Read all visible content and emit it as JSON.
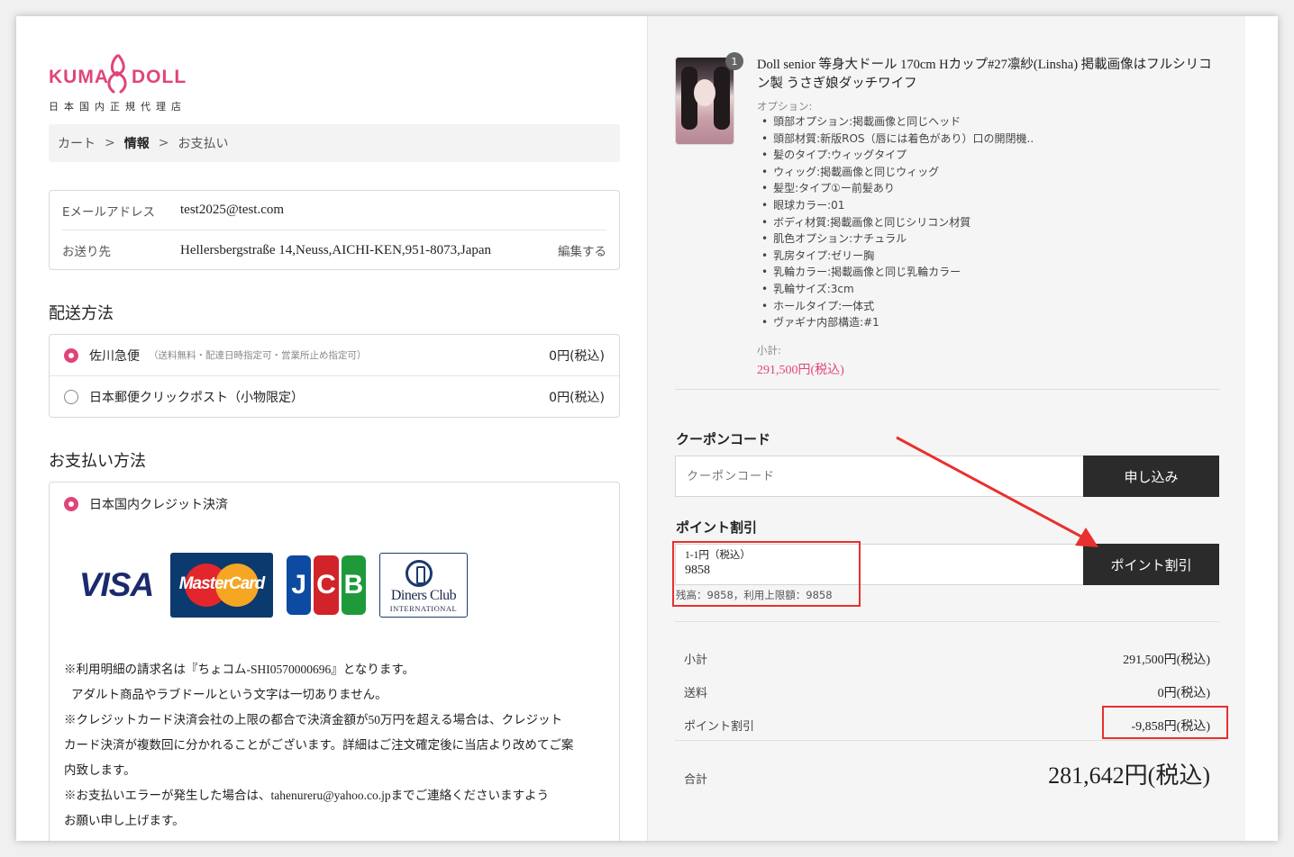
{
  "logo": {
    "brand_left": "KUMA",
    "brand_right": "DOLL",
    "subtitle": "日本国内正規代理店"
  },
  "breadcrumb": {
    "items": [
      "カート",
      "情報",
      "お支払い"
    ],
    "separator": ">"
  },
  "contact": {
    "email_label": "Eメールアドレス",
    "email_value": "test2025@test.com",
    "ship_label": "お送り先",
    "ship_value": "Hellersbergstraße 14,Neuss,AICHI-KEN,951-8073,Japan",
    "edit_label": "編集する"
  },
  "shipping": {
    "title": "配送方法",
    "options": [
      {
        "name": "佐川急便",
        "note": "（送料無料・配達日時指定可・営業所止め指定可）",
        "price": "0円(税込)",
        "selected": true
      },
      {
        "name": "日本郵便クリックポスト（小物限定）",
        "note": "",
        "price": "0円(税込)",
        "selected": false
      }
    ]
  },
  "payment": {
    "title": "お支払い方法",
    "method": "日本国内クレジット決済",
    "cards": {
      "visa": "VISA",
      "mastercard": "MasterCard",
      "jcb": [
        "J",
        "C",
        "B"
      ],
      "diners_line1": "Diners Club",
      "diners_line2": "INTERNATIONAL"
    },
    "notes": [
      "※利用明細の請求名は『ちょコム-SHI0570000696』となります。",
      "アダルト商品やラブドールという文字は一切ありません。",
      "※クレジットカード決済会社の上限の都合で決済金額が50万円を超える場合は、クレジット",
      "カード決済が複数回に分かれることがございます。詳細はご注文確定後に当店より改めてご案",
      "内致します。",
      "※お支払いエラーが発生した場合は、tahenureru@yahoo.co.jpまでご連絡くださいますよう",
      "お願い申し上げます。"
    ]
  },
  "product": {
    "quantity": "1",
    "title": "Doll senior 等身大ドール 170cm Hカップ#27凛紗(Linsha) 掲載画像はフルシリコン製 うさぎ娘ダッチワイフ",
    "options_label": "オプション:",
    "options": [
      "頭部オプション:掲載画像と同じヘッド",
      "頭部材質:新版ROS（唇には着色があり）口の開閉機..",
      "髪のタイプ:ウィッグタイプ",
      "ウィッグ:掲載画像と同じウィッグ",
      "髪型:タイプ①ー前髪あり",
      "眼球カラー:01",
      "ボディ材質:掲載画像と同じシリコン材質",
      "肌色オプション:ナチュラル",
      "乳房タイプ:ゼリー胸",
      "乳輪カラー:掲載画像と同じ乳輪カラー",
      "乳輪サイズ:3cm",
      "ホールタイプ:一体式",
      "ヴァギナ内部構造:#1"
    ],
    "subtotal_label": "小計:",
    "subtotal_value": "291,500円(税込)"
  },
  "coupon": {
    "title": "クーポンコード",
    "placeholder": "クーポンコード",
    "button": "申し込み"
  },
  "points": {
    "title": "ポイント割引",
    "field_label": "1-1円（税込）",
    "field_value": "9858",
    "button": "ポイント割引",
    "hint": "残高：9858，利用上限額：9858"
  },
  "summary": {
    "subtotal_label": "小計",
    "subtotal_value": "291,500円(税込)",
    "shipping_label": "送料",
    "shipping_value": "0円(税込)",
    "discount_label": "ポイント割引",
    "discount_value": "-9,858円(税込)",
    "total_label": "合計",
    "total_value": "281,642円(税込)"
  },
  "colors": {
    "accent": "#e0457a",
    "annotation": "#e8302f",
    "button": "#2b2b2b"
  }
}
